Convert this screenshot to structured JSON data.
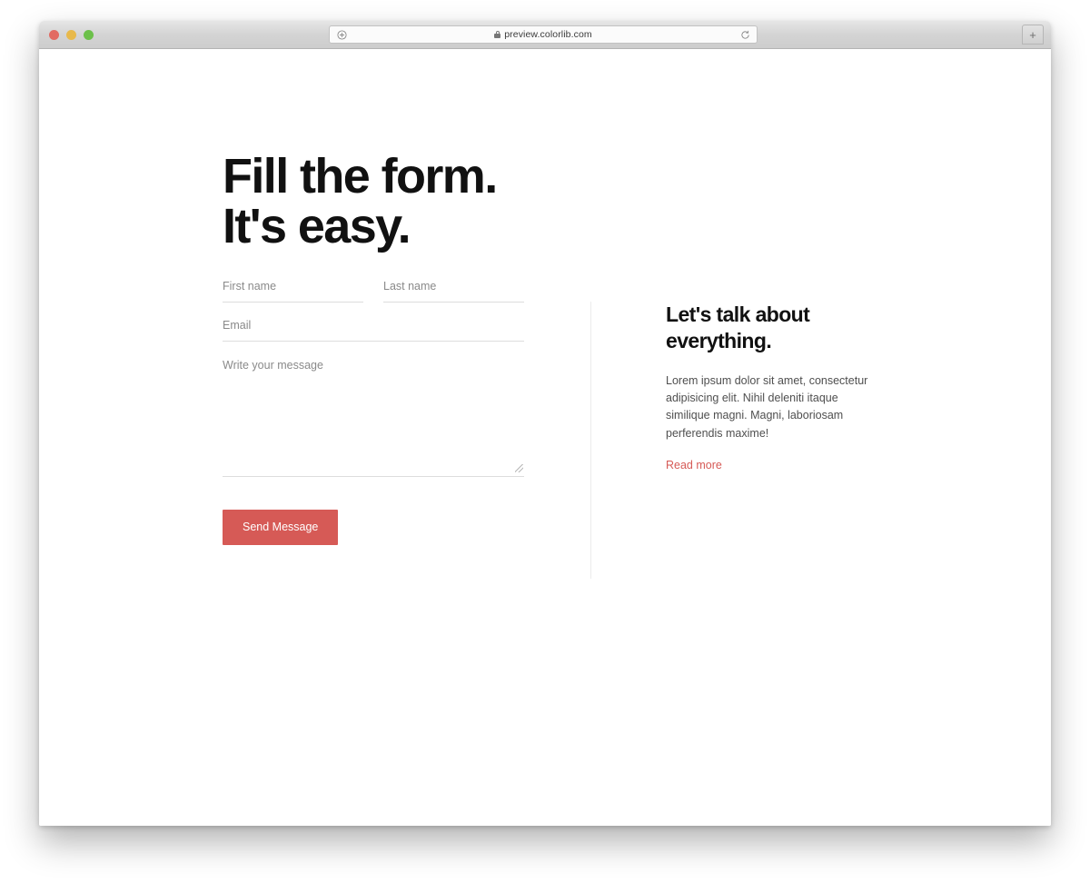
{
  "browser": {
    "traffic_lights": [
      "close",
      "minimize",
      "maximize"
    ],
    "address_bar": {
      "url": "preview.colorlib.com",
      "security_icon": "lock-icon",
      "left_icon": "page-info-icon",
      "reload_icon": "reload-icon"
    },
    "new_tab_label": "+"
  },
  "page": {
    "heading_line1": "Fill the form.",
    "heading_line2": "It's easy.",
    "form": {
      "first_name_placeholder": "First name",
      "first_name_value": "",
      "last_name_placeholder": "Last name",
      "last_name_value": "",
      "email_placeholder": "Email",
      "email_value": "",
      "message_placeholder": "Write your message",
      "message_value": "",
      "submit_label": "Send Message"
    },
    "info": {
      "title_line1": "Let's talk about",
      "title_line2": "everything.",
      "paragraph": "Lorem ipsum dolor sit amet, consectetur adipisicing elit. Nihil deleniti itaque similique magni. Magni, laboriosam perferendis maxime!",
      "read_more_label": "Read more"
    }
  },
  "colors": {
    "accent": "#d65a56",
    "heading": "#111111",
    "body_text": "#4f4f4f",
    "placeholder": "#8a8a8a",
    "underline": "#dddddd",
    "divider": "#ececec"
  }
}
